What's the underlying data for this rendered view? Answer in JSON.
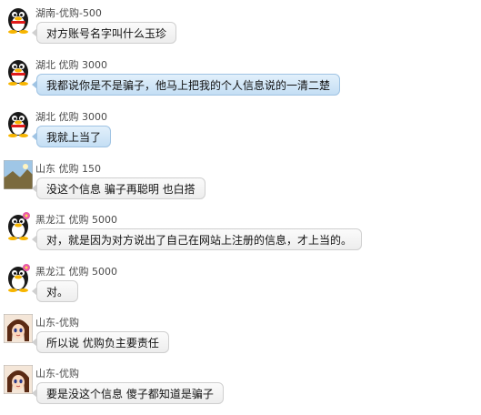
{
  "messages": [
    {
      "sender": "湖南-优购-500",
      "text": "对方账号名字叫什么玉珍",
      "style": "grey",
      "avatar": "qq-penguin-icon"
    },
    {
      "sender": "湖北 优购 3000",
      "text": "我都说你是不是骗子，他马上把我的个人信息说的一清二楚",
      "style": "blue",
      "avatar": "qq-penguin-icon"
    },
    {
      "sender": "湖北 优购 3000",
      "text": "我就上当了",
      "style": "blue",
      "avatar": "qq-penguin-icon"
    },
    {
      "sender": "山东 优购 150",
      "text": "没这个信息 骗子再聪明 也白搭",
      "style": "grey",
      "avatar": "landscape-avatar-icon"
    },
    {
      "sender": "黑龙江 优购 5000",
      "text": "对，就是因为对方说出了自己在网站上注册的信息，才上当的。",
      "style": "grey",
      "avatar": "qq-penguin-flower-icon"
    },
    {
      "sender": "黑龙江 优购 5000",
      "text": "对。",
      "style": "grey",
      "avatar": "qq-penguin-flower-icon"
    },
    {
      "sender": "山东-优购",
      "text": "所以说 优购负主要责任",
      "style": "grey",
      "avatar": "anime-girl-avatar-icon"
    },
    {
      "sender": "山东-优购",
      "text": "要是没这个信息 傻子都知道是骗子",
      "style": "grey",
      "avatar": "anime-girl-avatar-icon"
    }
  ]
}
